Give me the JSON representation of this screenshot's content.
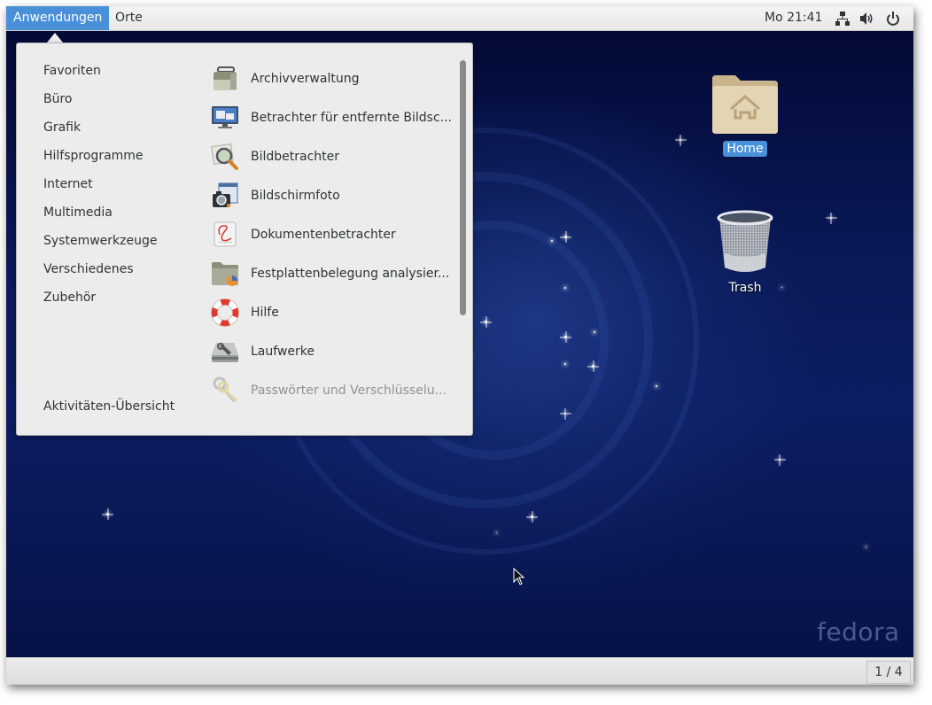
{
  "top_panel": {
    "applications_label": "Anwendungen",
    "places_label": "Orte",
    "clock": "Mo 21:41",
    "tray_icons": [
      "network-icon",
      "volume-icon",
      "power-icon"
    ]
  },
  "apps_menu": {
    "categories": [
      {
        "label": "Favoriten"
      },
      {
        "label": "Büro"
      },
      {
        "label": "Grafik"
      },
      {
        "label": "Hilfsprogramme"
      },
      {
        "label": "Internet"
      },
      {
        "label": "Multimedia"
      },
      {
        "label": "Systemwerkzeuge"
      },
      {
        "label": "Verschiedenes"
      },
      {
        "label": "Zubehör"
      }
    ],
    "overview_label": "Aktivitäten-Übersicht",
    "apps": [
      {
        "label": "Archivverwaltung",
        "icon": "archive-manager-icon"
      },
      {
        "label": "Betrachter für entfernte Bildsc...",
        "icon": "remote-desktop-viewer-icon"
      },
      {
        "label": "Bildbetrachter",
        "icon": "image-viewer-icon"
      },
      {
        "label": "Bildschirmfoto",
        "icon": "screenshot-camera-icon"
      },
      {
        "label": "Dokumentenbetrachter",
        "icon": "document-viewer-icon"
      },
      {
        "label": "Festplattenbelegung analysier...",
        "icon": "disk-usage-analyzer-icon"
      },
      {
        "label": "Hilfe",
        "icon": "help-lifebuoy-icon"
      },
      {
        "label": "Laufwerke",
        "icon": "disks-icon"
      },
      {
        "label": "Passwörter und Verschlüsselu...",
        "icon": "passwords-keys-icon"
      }
    ]
  },
  "desktop": {
    "icons": [
      {
        "label": "Home",
        "icon": "home-folder-icon",
        "selected": true
      },
      {
        "label": "Trash",
        "icon": "trash-icon",
        "selected": false
      }
    ],
    "watermark": "fedora"
  },
  "bottom_bar": {
    "workspace_indicator": "1 / 4"
  },
  "colors": {
    "accent": "#4a90d9",
    "menu_bg": "#ececec",
    "desktop_bg": "#0a1a5a"
  }
}
